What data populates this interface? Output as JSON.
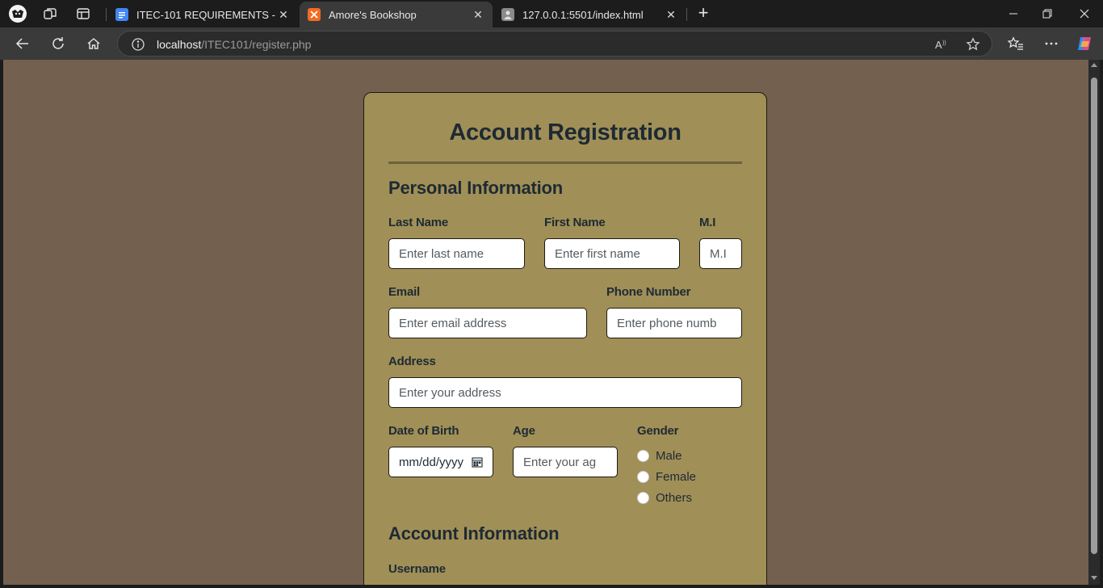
{
  "browser": {
    "tabs": [
      {
        "title": "ITEC-101 REQUIREMENTS - Goog",
        "favicon": "google-docs-icon",
        "active": false
      },
      {
        "title": "Amore's Bookshop",
        "favicon": "xampp-icon",
        "active": true
      },
      {
        "title": "127.0.0.1:5501/index.html",
        "favicon": "page-thumbnail-icon",
        "active": false
      }
    ],
    "address": {
      "host": "localhost",
      "path": "/ITEC101/register.php"
    }
  },
  "form": {
    "title": "Account Registration",
    "personal_heading": "Personal Information",
    "fields": {
      "last_name": {
        "label": "Last Name",
        "placeholder": "Enter last name"
      },
      "first_name": {
        "label": "First Name",
        "placeholder": "Enter first name"
      },
      "mi": {
        "label": "M.I",
        "placeholder": "M.I"
      },
      "email": {
        "label": "Email",
        "placeholder": "Enter email address"
      },
      "phone": {
        "label": "Phone Number",
        "placeholder": "Enter phone numb"
      },
      "address": {
        "label": "Address",
        "placeholder": "Enter your address"
      },
      "dob": {
        "label": "Date of Birth",
        "value": "mm/dd/yyyy"
      },
      "age": {
        "label": "Age",
        "placeholder": "Enter your ag"
      }
    },
    "gender": {
      "label": "Gender",
      "options": [
        "Male",
        "Female",
        "Others"
      ]
    },
    "account_heading": "Account Information",
    "username_label": "Username"
  },
  "colors": {
    "page_background": "#73604f",
    "card_background": "#a08f57",
    "text": "#1e2a33"
  }
}
